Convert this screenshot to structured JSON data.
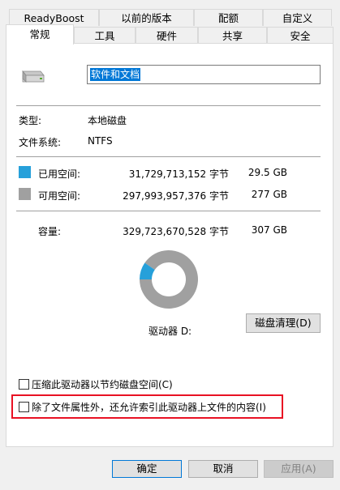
{
  "tabs_row1": [
    {
      "label": "ReadyBoost"
    },
    {
      "label": "以前的版本"
    },
    {
      "label": "配额"
    },
    {
      "label": "自定义"
    }
  ],
  "tabs_row2": [
    {
      "label": "常规",
      "active": true
    },
    {
      "label": "工具"
    },
    {
      "label": "硬件"
    },
    {
      "label": "共享"
    },
    {
      "label": "安全"
    }
  ],
  "drive_name": "软件和文档",
  "type_label": "类型:",
  "type_value": "本地磁盘",
  "fs_label": "文件系统:",
  "fs_value": "NTFS",
  "used": {
    "label": "已用空间:",
    "bytes": "31,729,713,152 字节",
    "size": "29.5 GB",
    "color": "#26a0da"
  },
  "free": {
    "label": "可用空间:",
    "bytes": "297,993,957,376 字节",
    "size": "277 GB",
    "color": "#a0a0a0"
  },
  "capacity": {
    "label": "容量:",
    "bytes": "329,723,670,528 字节",
    "size": "307 GB"
  },
  "usage_fraction": 0.0962,
  "drive_label": "驱动器 D:",
  "cleanup_button": "磁盘清理(D)",
  "compress_checkbox": "压缩此驱动器以节约磁盘空间(C)",
  "index_checkbox": "除了文件属性外，还允许索引此驱动器上文件的内容(I)",
  "buttons": {
    "ok": "确定",
    "cancel": "取消",
    "apply": "应用(A)"
  },
  "highlight_color": "#e81123"
}
